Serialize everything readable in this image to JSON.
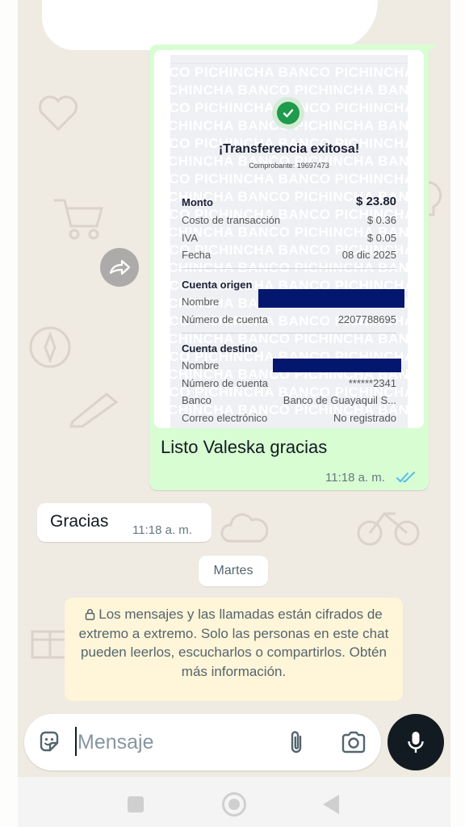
{
  "receipt": {
    "watermark": "BANCO PICHINCHA",
    "title": "¡Transferencia exitosa!",
    "voucher": "Comprobante: 19697473",
    "monto_label": "Monto",
    "monto_value": "$ 23.80",
    "costo_label": "Costo de transacción",
    "costo_value": "$ 0.36",
    "iva_label": "IVA",
    "iva_value": "$ 0.05",
    "fecha_label": "Fecha",
    "fecha_value": "08 dic 2025",
    "origen_heading": "Cuenta origen",
    "origen_nombre_label": "Nombre",
    "origen_cuenta_label": "Número de cuenta",
    "origen_cuenta_value": "2207788695",
    "destino_heading": "Cuenta destino",
    "destino_nombre_label": "Nombre",
    "destino_cuenta_label": "Número de cuenta",
    "destino_cuenta_value": "******2341",
    "banco_label": "Banco",
    "banco_value": "Banco de Guayaquil S...",
    "correo_label": "Correo electrónico",
    "correo_value": "No registrado"
  },
  "outgoing": {
    "caption": "Listo Valeska gracias",
    "time": "11:18 a. m.",
    "status_icon": "double-check-read",
    "status_color": "#53bdeb"
  },
  "incoming": {
    "text": "Gracias",
    "time": "11:18 a. m."
  },
  "date_chip": "Martes",
  "encryption_notice": "Los mensajes y las llamadas están cifrados de extremo a extremo. Solo las personas en este chat pueden leerlos, escucharlos o compartirlos. Obtén más información.",
  "composer": {
    "placeholder": "Mensaje",
    "icons": [
      "sticker-icon",
      "attach-clip-icon",
      "camera-icon",
      "microphone-icon"
    ]
  },
  "colors": {
    "outgoing_bubble": "#d9fdd3",
    "chat_background": "#efeae2",
    "notice_background": "#fff5d8",
    "success_green": "#1e9b4b",
    "bank_navy": "#1b2034"
  },
  "navbar_icons": [
    "recents-icon",
    "home-icon",
    "back-icon"
  ]
}
